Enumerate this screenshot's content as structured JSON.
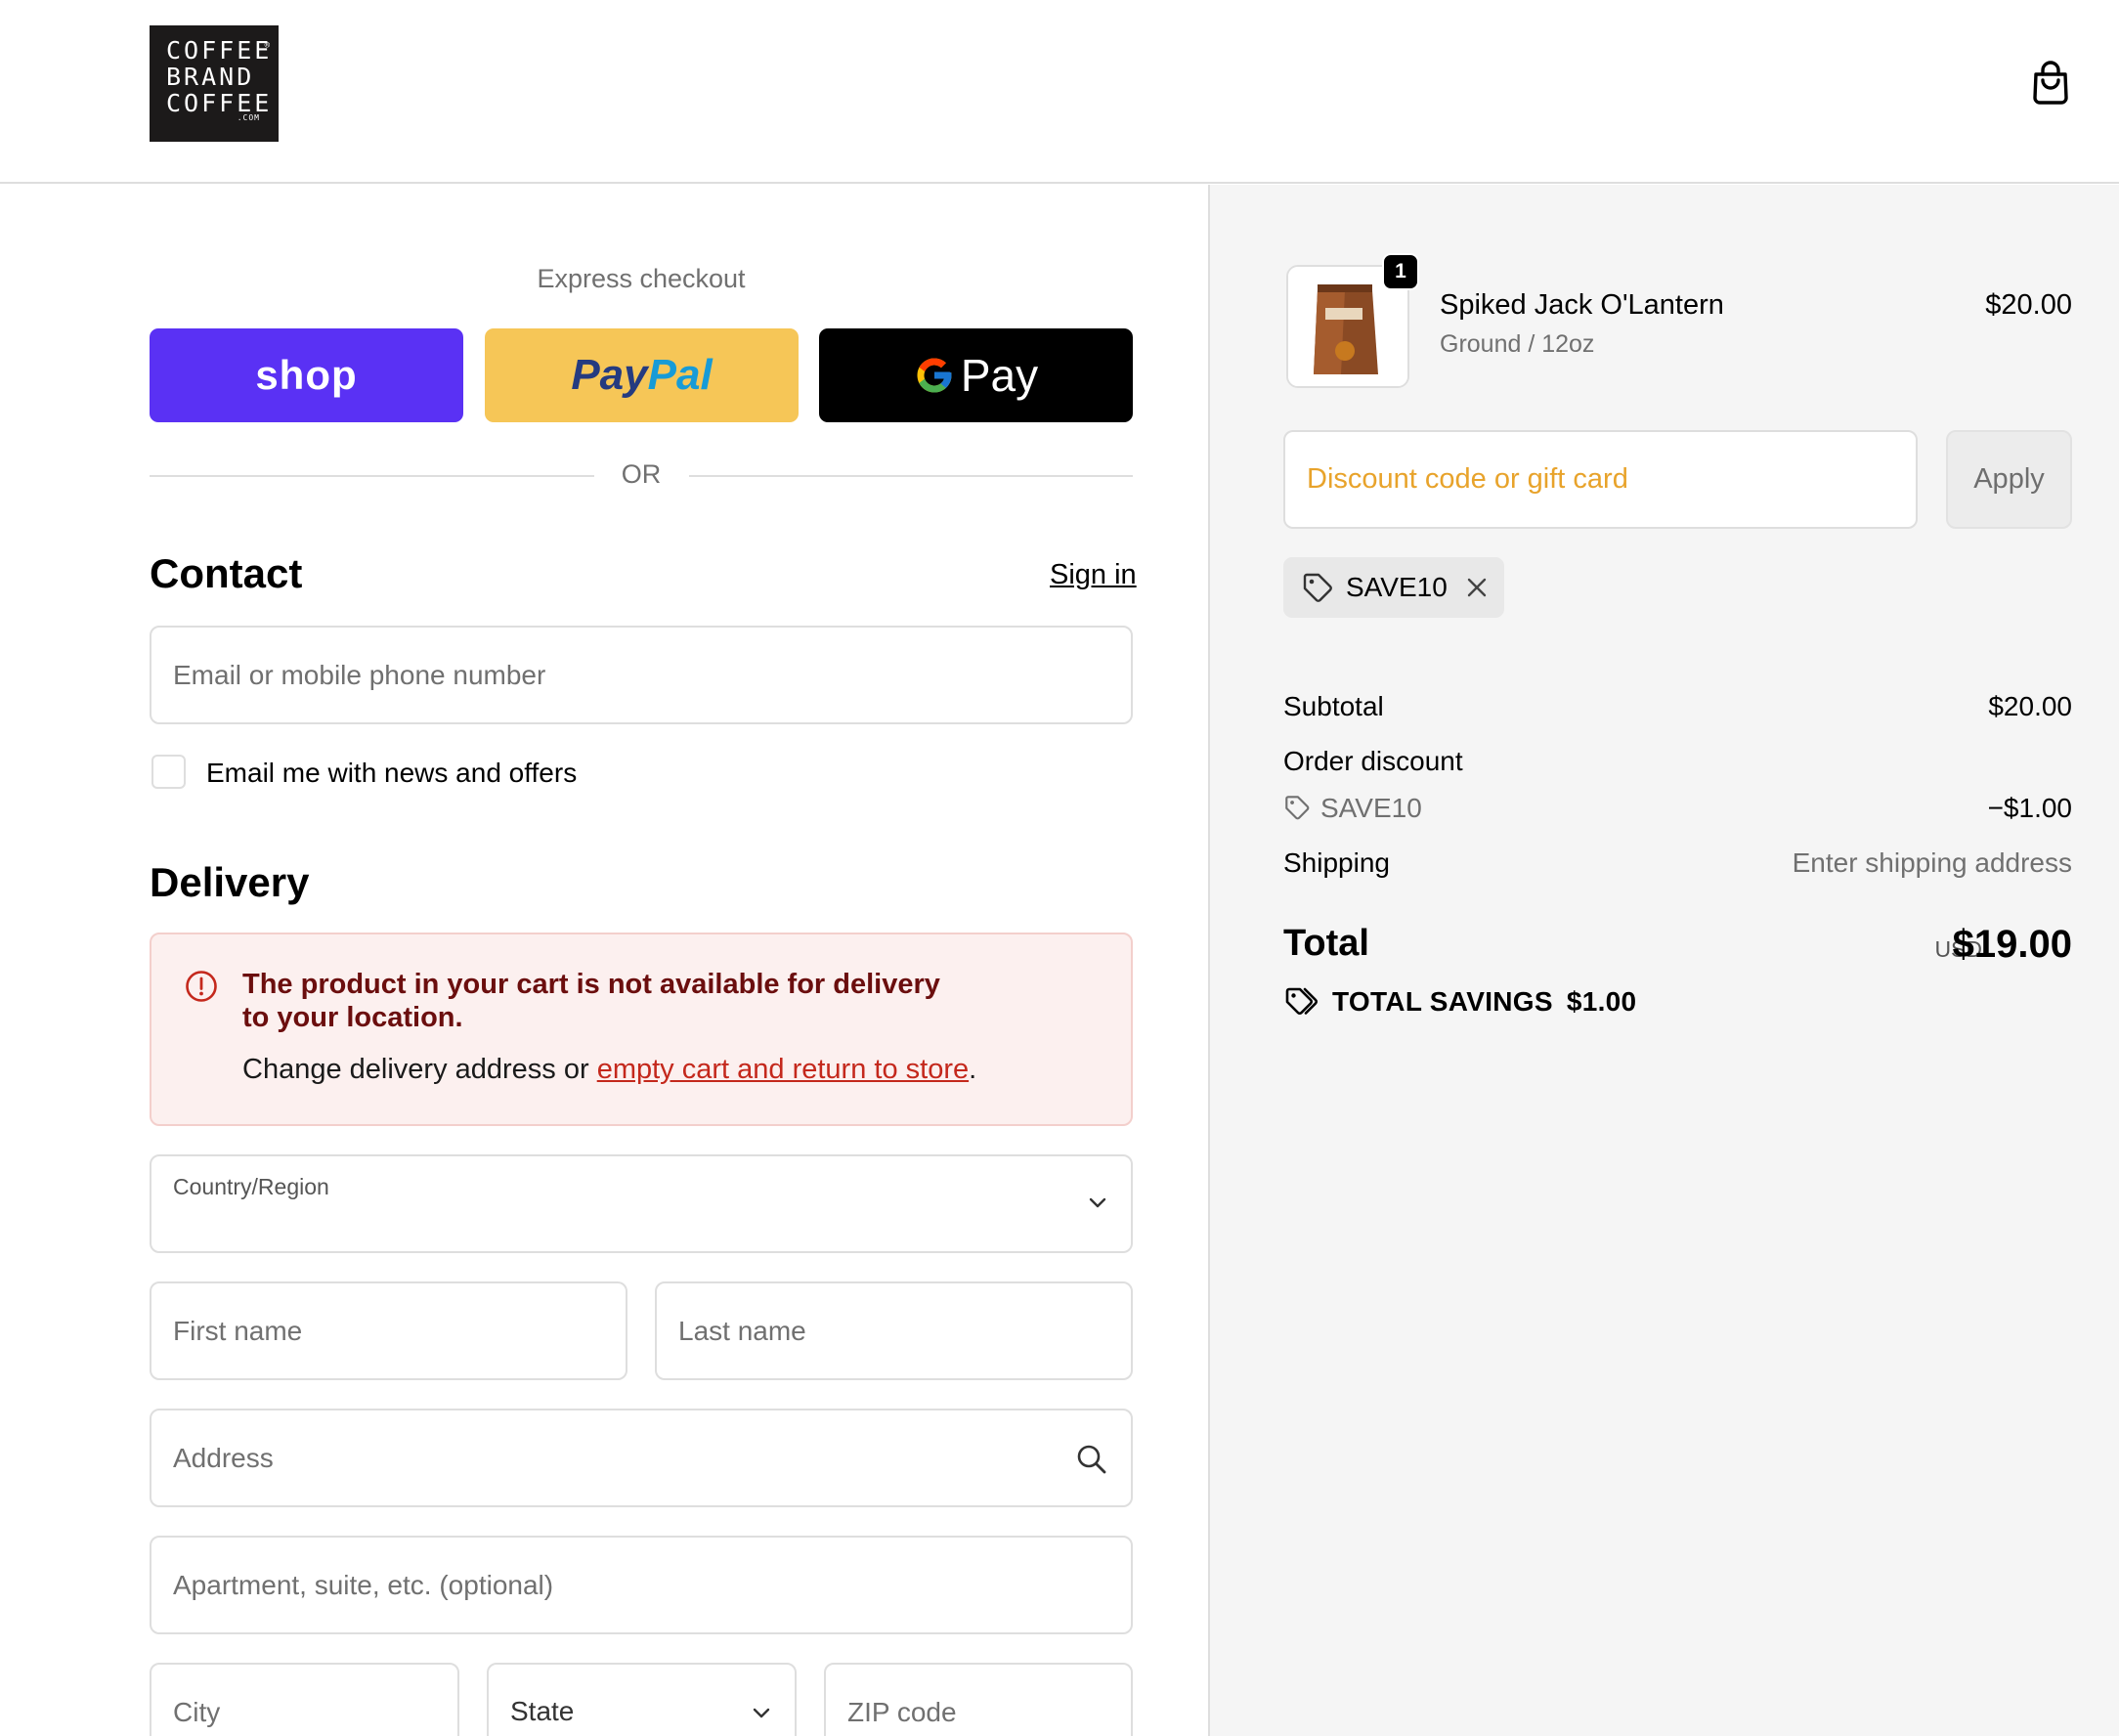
{
  "brand": {
    "logo_lines": [
      "COFFEE",
      "BRAND",
      "COFFEE"
    ],
    "logo_reg": "®",
    "logo_com": ".COM"
  },
  "express": {
    "label": "Express checkout",
    "shop_label": "shop",
    "paypal_part1": "Pay",
    "paypal_part2": "Pal",
    "gpay_label": "Pay",
    "or_label": "OR"
  },
  "contact": {
    "title": "Contact",
    "sign_in": "Sign in",
    "email_placeholder": "Email or mobile phone number",
    "news_checkbox_label": "Email me with news and offers"
  },
  "delivery": {
    "title": "Delivery",
    "alert_title": "The product in your cart is not available for delivery to your location.",
    "alert_body_prefix": "Change delivery address or ",
    "alert_link": "empty cart and return to store",
    "alert_body_suffix": ".",
    "country_label": "Country/Region",
    "first_name_placeholder": "First name",
    "last_name_placeholder": "Last name",
    "address_placeholder": "Address",
    "apartment_placeholder": "Apartment, suite, etc. (optional)",
    "city_placeholder": "City",
    "state_label": "State",
    "zip_placeholder": "ZIP code"
  },
  "order": {
    "item": {
      "quantity": "1",
      "name": "Spiked Jack O'Lantern",
      "variant": "Ground / 12oz",
      "price": "$20.00"
    },
    "discount_placeholder": "Discount code or gift card",
    "apply_label": "Apply",
    "applied_code": "SAVE10",
    "subtotal_label": "Subtotal",
    "subtotal_value": "$20.00",
    "order_discount_label": "Order discount",
    "discount_code": "SAVE10",
    "discount_value": "−$1.00",
    "shipping_label": "Shipping",
    "shipping_value": "Enter shipping address",
    "total_label": "Total",
    "currency": "USD",
    "total_value": "$19.00",
    "savings_label": "TOTAL SAVINGS",
    "savings_value": "$1.00"
  },
  "colors": {
    "shop": "#5a31f4",
    "paypal": "#f6c657",
    "gpay": "#000000",
    "alert_bg": "#fcf0ef",
    "alert_link": "#c4281c",
    "discount_placeholder": "#e8a32b"
  }
}
